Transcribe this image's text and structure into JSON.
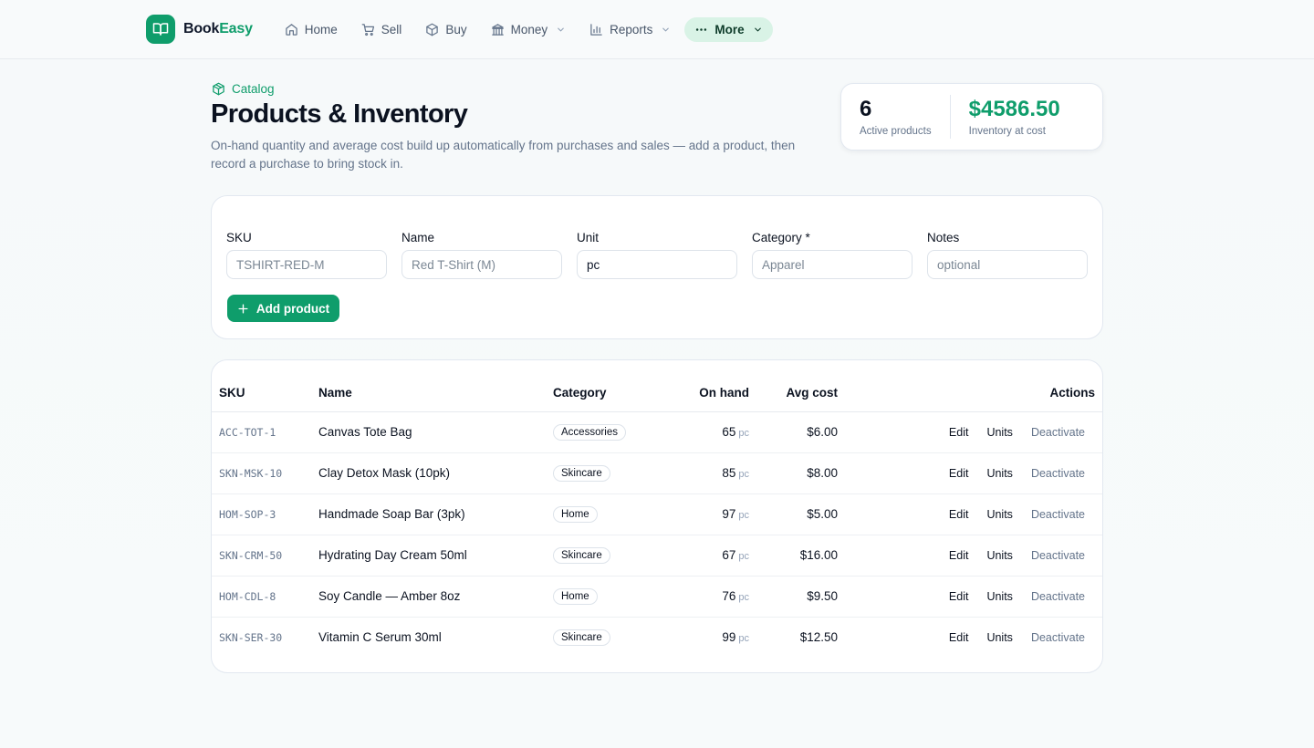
{
  "brand": {
    "name_part1": "Book",
    "name_part2": "Easy"
  },
  "nav": [
    {
      "label": "Home",
      "icon": "home-icon"
    },
    {
      "label": "Sell",
      "icon": "cart-icon"
    },
    {
      "label": "Buy",
      "icon": "box-icon"
    },
    {
      "label": "Money",
      "icon": "bank-icon",
      "dropdown": true
    },
    {
      "label": "Reports",
      "icon": "chart-icon",
      "dropdown": true
    },
    {
      "label": "More",
      "icon": "dots-icon",
      "dropdown": true,
      "active": true
    }
  ],
  "header": {
    "eyebrow": "Catalog",
    "title": "Products & Inventory",
    "description": "On-hand quantity and average cost build up automatically from purchases and sales — add a product, then record a purchase to bring stock in."
  },
  "stats": {
    "active_products_value": "6",
    "active_products_label": "Active products",
    "inventory_value": "$4586.50",
    "inventory_label": "Inventory at cost"
  },
  "form": {
    "sku": {
      "label": "SKU",
      "placeholder": "TSHIRT-RED-M",
      "value": ""
    },
    "name": {
      "label": "Name",
      "placeholder": "Red T-Shirt (M)",
      "value": ""
    },
    "unit": {
      "label": "Unit",
      "placeholder": "",
      "value": "pc"
    },
    "category": {
      "label": "Category *",
      "placeholder": "Apparel",
      "value": ""
    },
    "notes": {
      "label": "Notes",
      "placeholder": "optional",
      "value": ""
    },
    "add_button": "Add product"
  },
  "table": {
    "columns": {
      "sku": "SKU",
      "name": "Name",
      "category": "Category",
      "on_hand": "On hand",
      "avg_cost": "Avg cost",
      "actions": "Actions"
    },
    "action_labels": {
      "edit": "Edit",
      "units": "Units",
      "deactivate": "Deactivate"
    },
    "rows": [
      {
        "sku": "ACC-TOT-1",
        "name": "Canvas Tote Bag",
        "category": "Accessories",
        "on_hand": "65",
        "unit": "pc",
        "avg_cost": "$6.00"
      },
      {
        "sku": "SKN-MSK-10",
        "name": "Clay Detox Mask (10pk)",
        "category": "Skincare",
        "on_hand": "85",
        "unit": "pc",
        "avg_cost": "$8.00"
      },
      {
        "sku": "HOM-SOP-3",
        "name": "Handmade Soap Bar (3pk)",
        "category": "Home",
        "on_hand": "97",
        "unit": "pc",
        "avg_cost": "$5.00"
      },
      {
        "sku": "SKN-CRM-50",
        "name": "Hydrating Day Cream 50ml",
        "category": "Skincare",
        "on_hand": "67",
        "unit": "pc",
        "avg_cost": "$16.00"
      },
      {
        "sku": "HOM-CDL-8",
        "name": "Soy Candle — Amber 8oz",
        "category": "Home",
        "on_hand": "76",
        "unit": "pc",
        "avg_cost": "$9.50"
      },
      {
        "sku": "SKN-SER-30",
        "name": "Vitamin C Serum 30ml",
        "category": "Skincare",
        "on_hand": "99",
        "unit": "pc",
        "avg_cost": "$12.50"
      }
    ]
  },
  "colors": {
    "brand": "#0f9d6b",
    "active_nav_bg": "#d9f3e6"
  }
}
